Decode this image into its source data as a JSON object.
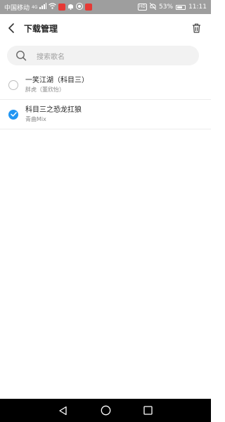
{
  "status_bar": {
    "carrier": "中国移动",
    "network": "4G",
    "battery": "53%",
    "time": "11:11"
  },
  "header": {
    "title": "下载管理"
  },
  "search": {
    "placeholder": "搜索歌名"
  },
  "songs": [
    {
      "title": "一笑江湖（科目三）",
      "artist": "胖虎（董欣怡）",
      "selected": false
    },
    {
      "title": "科目三之恐龙扛狼",
      "artist": "青曲Mix",
      "selected": true
    }
  ],
  "colors": {
    "accent": "#2196f3",
    "status_bar": "#9e9e9e",
    "nav_bar": "#000000"
  }
}
